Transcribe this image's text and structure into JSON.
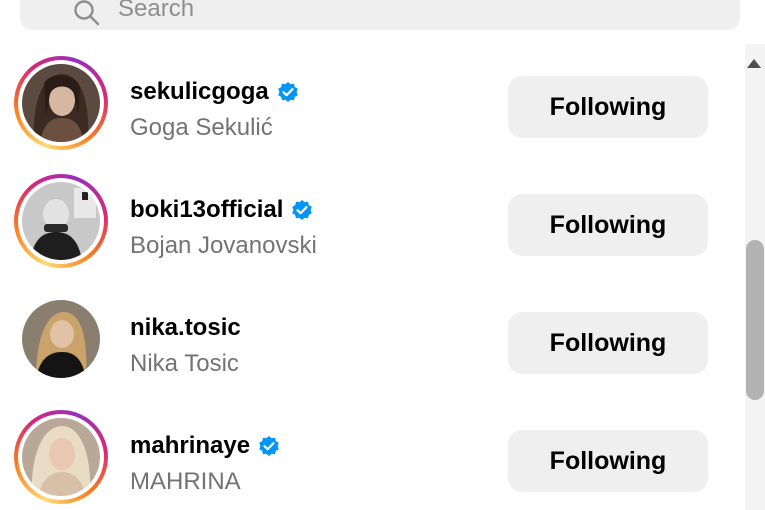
{
  "search": {
    "placeholder": "Search",
    "icon": "search-icon"
  },
  "accent_color": "#0095f6",
  "list": [
    {
      "username": "sekulicgoga",
      "full_name": "Goga Sekulić",
      "verified": true,
      "has_story": true,
      "button_label": "Following"
    },
    {
      "username": "boki13official",
      "full_name": "Bojan Jovanovski",
      "verified": true,
      "has_story": true,
      "button_label": "Following"
    },
    {
      "username": "nika.tosic",
      "full_name": "Nika Tosic",
      "verified": false,
      "has_story": false,
      "button_label": "Following"
    },
    {
      "username": "mahrinaye",
      "full_name": "MAHRINA",
      "verified": true,
      "has_story": true,
      "button_label": "Following"
    }
  ]
}
